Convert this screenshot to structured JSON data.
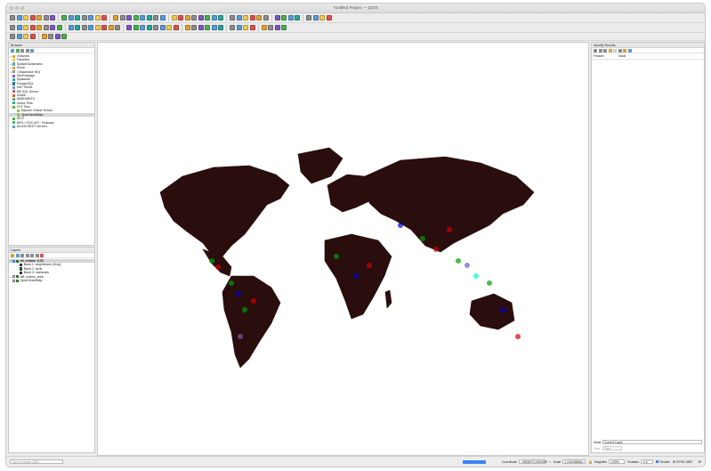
{
  "window": {
    "title": "*Untitled Project — QGIS"
  },
  "browser": {
    "title": "Browser",
    "items": [
      {
        "label": "/Volumes",
        "icon": "folder-icon",
        "expand": "▸"
      },
      {
        "label": "Favorites",
        "icon": "star-icon",
        "expand": ""
      },
      {
        "label": "Spatial Bookmarks",
        "icon": "bookmark-icon",
        "expand": "▸"
      },
      {
        "label": "Home",
        "icon": "home-icon",
        "expand": "▸"
      },
      {
        "label": "/ (Macintosh HD)",
        "icon": "drive-icon",
        "expand": "▸"
      },
      {
        "label": "GeoPackage",
        "icon": "geopackage-icon",
        "expand": ""
      },
      {
        "label": "SpatiaLite",
        "icon": "spatialite-icon",
        "expand": ""
      },
      {
        "label": "PostgreSQL",
        "icon": "postgresql-icon",
        "expand": "▸"
      },
      {
        "label": "SAP HANA",
        "icon": "database-icon",
        "expand": ""
      },
      {
        "label": "MS SQL Server",
        "icon": "mssql-icon",
        "expand": ""
      },
      {
        "label": "Oracle",
        "icon": "oracle-icon",
        "expand": ""
      },
      {
        "label": "WMS/WMTS",
        "icon": "wms-icon",
        "expand": ""
      },
      {
        "label": "Vector Tiles",
        "icon": "vector-tiles-icon",
        "expand": ""
      },
      {
        "label": "XYZ Tiles",
        "icon": "xyz-tiles-icon",
        "expand": "▾"
      },
      {
        "label": "Mapzen Global Terrain",
        "icon": "tile-icon",
        "expand": "",
        "indent": true
      },
      {
        "label": "OpenStreetMap",
        "icon": "tile-icon",
        "expand": "",
        "indent": true,
        "selected": true
      },
      {
        "label": "WCS",
        "icon": "wcs-icon",
        "expand": ""
      },
      {
        "label": "WFS / OGC API - Features",
        "icon": "wfs-icon",
        "expand": ""
      },
      {
        "label": "ArcGIS REST Servers",
        "icon": "arcgis-icon",
        "expand": ""
      }
    ]
  },
  "layers": {
    "title": "Layers",
    "items": [
      {
        "label": "all_realms_0.25",
        "kind": "raster",
        "expand": "▾",
        "checked": true,
        "selected": true
      },
      {
        "label": "Band 1: amphibians (Gray)",
        "kind": "band",
        "color": "#d40000"
      },
      {
        "label": "Band 2: birds",
        "kind": "band",
        "color": "#00a000"
      },
      {
        "label": "Band 3: mammals",
        "kind": "band",
        "color": "#0000d4"
      },
      {
        "label": "diff_realms_area",
        "kind": "raster",
        "expand": "▸",
        "checked": false
      },
      {
        "label": "OpenStreetMap",
        "kind": "raster",
        "expand": "",
        "checked": false
      }
    ]
  },
  "identify": {
    "title": "Identify Results",
    "columns": [
      "Feature",
      "Value"
    ],
    "mode_label": "Mode",
    "mode_value": "Current Layer",
    "view_label": "View",
    "view_value": "Tree"
  },
  "status": {
    "search_placeholder": "Type to locate (⌘K)",
    "coordinate_label": "Coordinate",
    "coordinate_value": "-9904672,2304900",
    "scale_label": "Scale",
    "scale_value": "1:161965844",
    "magnifier_label": "Magnifier",
    "magnifier_value": "100%",
    "rotation_label": "Rotation",
    "rotation_value": "0.0 °",
    "render_label": "Render",
    "crs_label": "EPSG:3857"
  },
  "colors": {
    "accent": "#3b82f6",
    "land_dark": "#2a0d0d",
    "amphibians": "#d40000",
    "birds": "#00a000",
    "mammals": "#0000d4"
  }
}
